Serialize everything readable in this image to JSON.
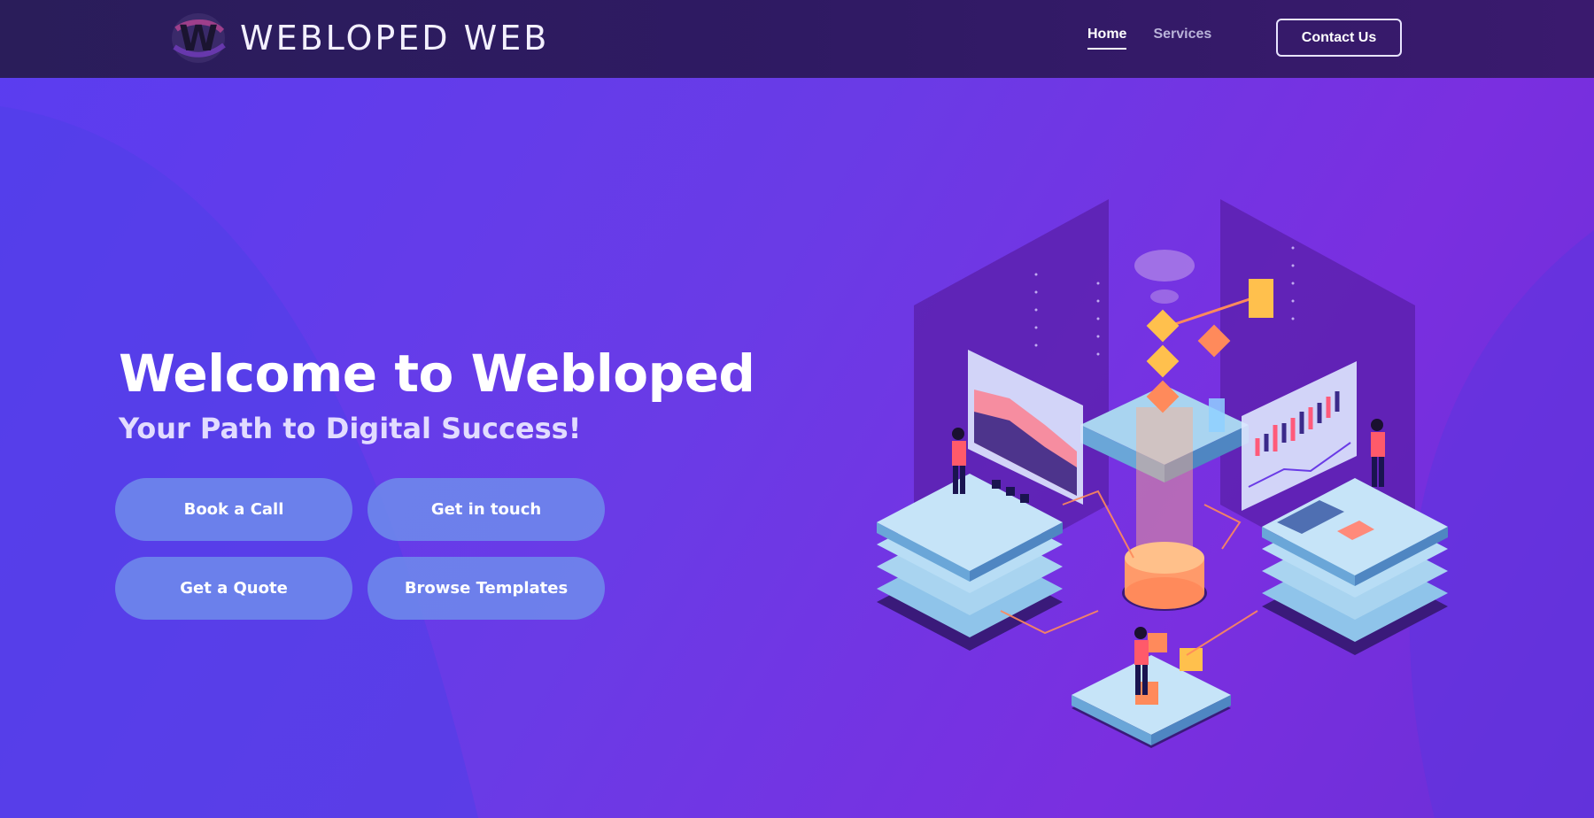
{
  "brand": {
    "name": "WEBLOPED WEB",
    "logo_letter": "W"
  },
  "nav": {
    "links": [
      {
        "label": "Home",
        "active": true
      },
      {
        "label": "Services",
        "active": false
      }
    ],
    "contact_label": "Contact Us"
  },
  "hero": {
    "title": "Welcome to Webloped",
    "subtitle": "Your Path to Digital Success!",
    "buttons": [
      "Book a Call",
      "Get in touch",
      "Get a Quote",
      "Browse Templates"
    ]
  },
  "colors": {
    "nav_bg": "#2f1a63",
    "hero_bg": "#6a3be6",
    "button_bg": "#6e8ceb",
    "accent_orange": "#ff8a5b",
    "accent_yellow": "#ffc04d"
  }
}
